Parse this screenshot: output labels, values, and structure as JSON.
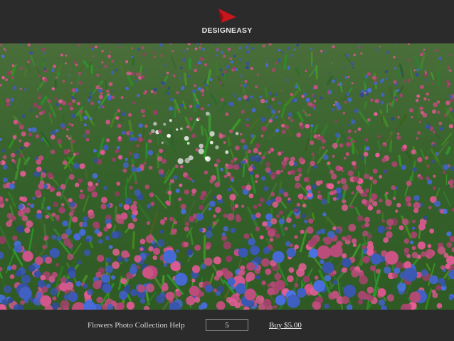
{
  "header": {
    "logo_icon": "red-play-triangle-icon",
    "brand_name": "DESIGNEASY",
    "accent_color": "#c8161d"
  },
  "photo": {
    "subject": "field of pink, blue and white flowers",
    "palette": {
      "foliage": "#3f6b2c",
      "pink": "#c2507f",
      "blue": "#3f5fbf",
      "white": "#e8ece6"
    }
  },
  "footer": {
    "menu_label": "Flowers Photo Collection Help",
    "quantity_value": "5",
    "buy_label": "Buy $5.00"
  }
}
